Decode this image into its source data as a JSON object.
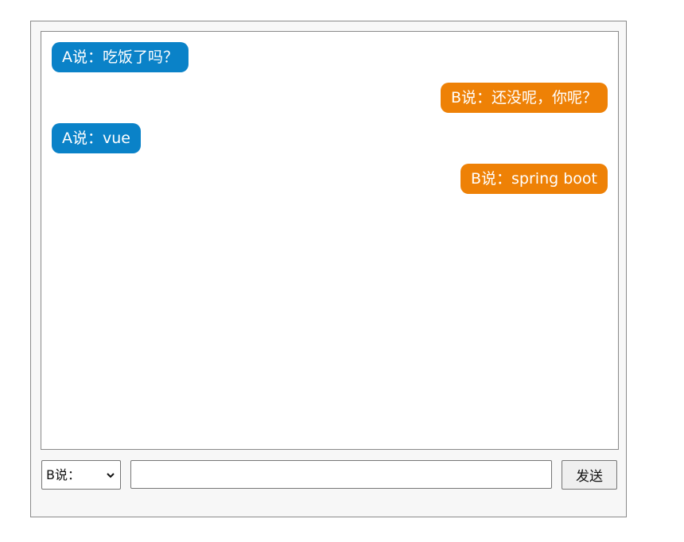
{
  "messages": [
    {
      "speaker": "A",
      "text": "A说：吃饭了吗？"
    },
    {
      "speaker": "B",
      "text": "B说：还没呢，你呢？"
    },
    {
      "speaker": "A",
      "text": "A说：vue"
    },
    {
      "speaker": "B",
      "text": "B说：spring boot"
    }
  ],
  "composer": {
    "speaker_selected": "B说：",
    "message_value": "",
    "send_label": "发送"
  },
  "colors": {
    "speaker_a_bubble": "#0a82c8",
    "speaker_b_bubble": "#ee8106"
  },
  "icons": {
    "select_arrow": "chevron-down-icon"
  }
}
